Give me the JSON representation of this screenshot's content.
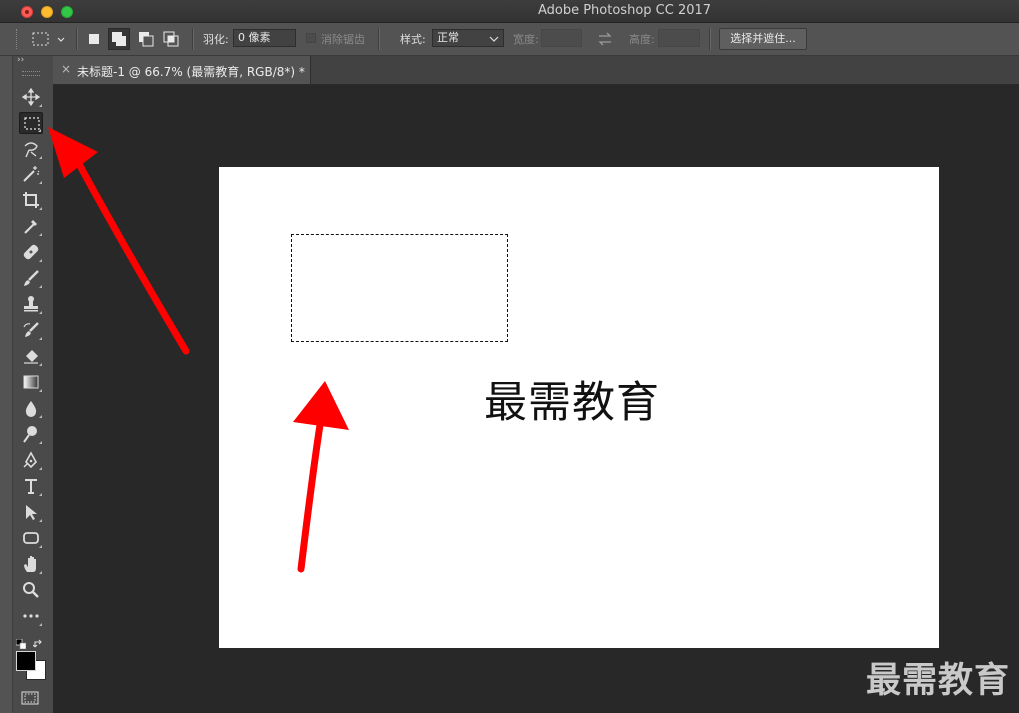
{
  "window": {
    "title": "Adobe Photoshop CC 2017"
  },
  "options_bar": {
    "feather_label": "羽化:",
    "feather_value": "0 像素",
    "antialias_label": "消除锯齿",
    "style_label": "样式:",
    "style_value": "正常",
    "width_label": "宽度:",
    "height_label": "高度:",
    "select_mask_button": "选择并遮住..."
  },
  "document_tab": {
    "close_glyph": "×",
    "label": "未标题-1 @ 66.7% (最需教育, RGB/8*) *"
  },
  "canvas": {
    "text": "最需教育"
  },
  "watermark": {
    "text": "最需教育"
  },
  "toolbox": {
    "collapse_glyph": "››",
    "tools": [
      {
        "name": "move-tool-icon",
        "glyph": "✥"
      },
      {
        "name": "rectangular-marquee-tool-icon",
        "glyph": ""
      },
      {
        "name": "lasso-tool-icon",
        "glyph": "ʘ"
      },
      {
        "name": "magic-wand-tool-icon",
        "glyph": "✨"
      },
      {
        "name": "crop-tool-icon",
        "glyph": "⌗"
      },
      {
        "name": "eyedropper-tool-icon",
        "glyph": "✎"
      },
      {
        "name": "healing-brush-tool-icon",
        "glyph": "✚"
      },
      {
        "name": "brush-tool-icon",
        "glyph": "✐"
      },
      {
        "name": "clone-stamp-tool-icon",
        "glyph": "♙"
      },
      {
        "name": "history-brush-tool-icon",
        "glyph": "✍"
      },
      {
        "name": "eraser-tool-icon",
        "glyph": "◆"
      },
      {
        "name": "gradient-tool-icon",
        "glyph": "▤"
      },
      {
        "name": "blur-tool-icon",
        "glyph": "💧"
      },
      {
        "name": "dodge-tool-icon",
        "glyph": "⚲"
      },
      {
        "name": "pen-tool-icon",
        "glyph": "✒"
      },
      {
        "name": "type-tool-icon",
        "glyph": "T"
      },
      {
        "name": "path-selection-tool-icon",
        "glyph": "➤"
      },
      {
        "name": "rectangle-shape-tool-icon",
        "glyph": "▢"
      },
      {
        "name": "hand-tool-icon",
        "glyph": "✋"
      },
      {
        "name": "zoom-tool-icon",
        "glyph": "🔍"
      },
      {
        "name": "edit-toolbar-icon",
        "glyph": "•••"
      }
    ]
  },
  "colors": {
    "foreground": "#000000",
    "background": "#ffffff",
    "annotation_arrow": "#ff0000"
  }
}
